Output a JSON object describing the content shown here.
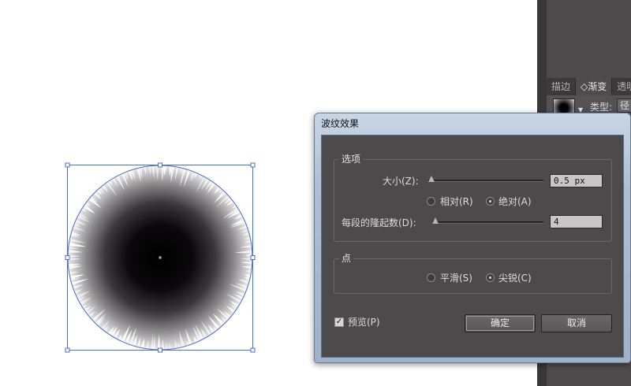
{
  "side_panel": {
    "tabs": [
      {
        "label": "描边"
      },
      {
        "label": "◇渐变"
      },
      {
        "label": "透明"
      }
    ],
    "type_label": "类型:",
    "type_value": "径"
  },
  "dialog": {
    "title": "波纹效果",
    "options_group": {
      "title": "选项",
      "size_label": "大小(Z):",
      "size_value": "0.5 px",
      "relative_label": "相对(R)",
      "absolute_label": "绝对(A)",
      "absolute_selected": true,
      "ridges_label": "每段的隆起数(D):",
      "ridges_value": "4"
    },
    "points_group": {
      "title": "点",
      "smooth_label": "平滑(S)",
      "corner_label": "尖锐(C)",
      "corner_selected": true
    },
    "preview_label": "预览(P)",
    "preview_checked": true,
    "ok_label": "确定",
    "cancel_label": "取消"
  },
  "colors": {
    "dialog_bg": "#4d4a4c",
    "panel_bg": "#4e4b4d",
    "selection": "#4a6ed0"
  }
}
